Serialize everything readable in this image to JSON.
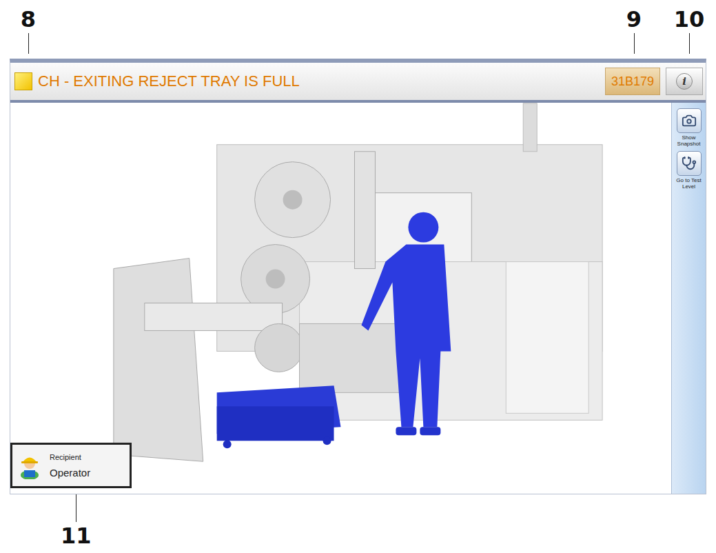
{
  "callouts": {
    "title_icon": "8",
    "code": "9",
    "info": "10",
    "recipient": "11"
  },
  "header": {
    "title": "CH - EXITING REJECT TRAY IS FULL",
    "code": "31B179",
    "info_button": "i"
  },
  "sidebar": {
    "buttons": [
      {
        "label": "Show Snapshot",
        "kind": "camera"
      },
      {
        "label": "Go to Test Level",
        "kind": "stethoscope"
      }
    ]
  },
  "recipient": {
    "label": "Recipient",
    "value": "Operator"
  }
}
